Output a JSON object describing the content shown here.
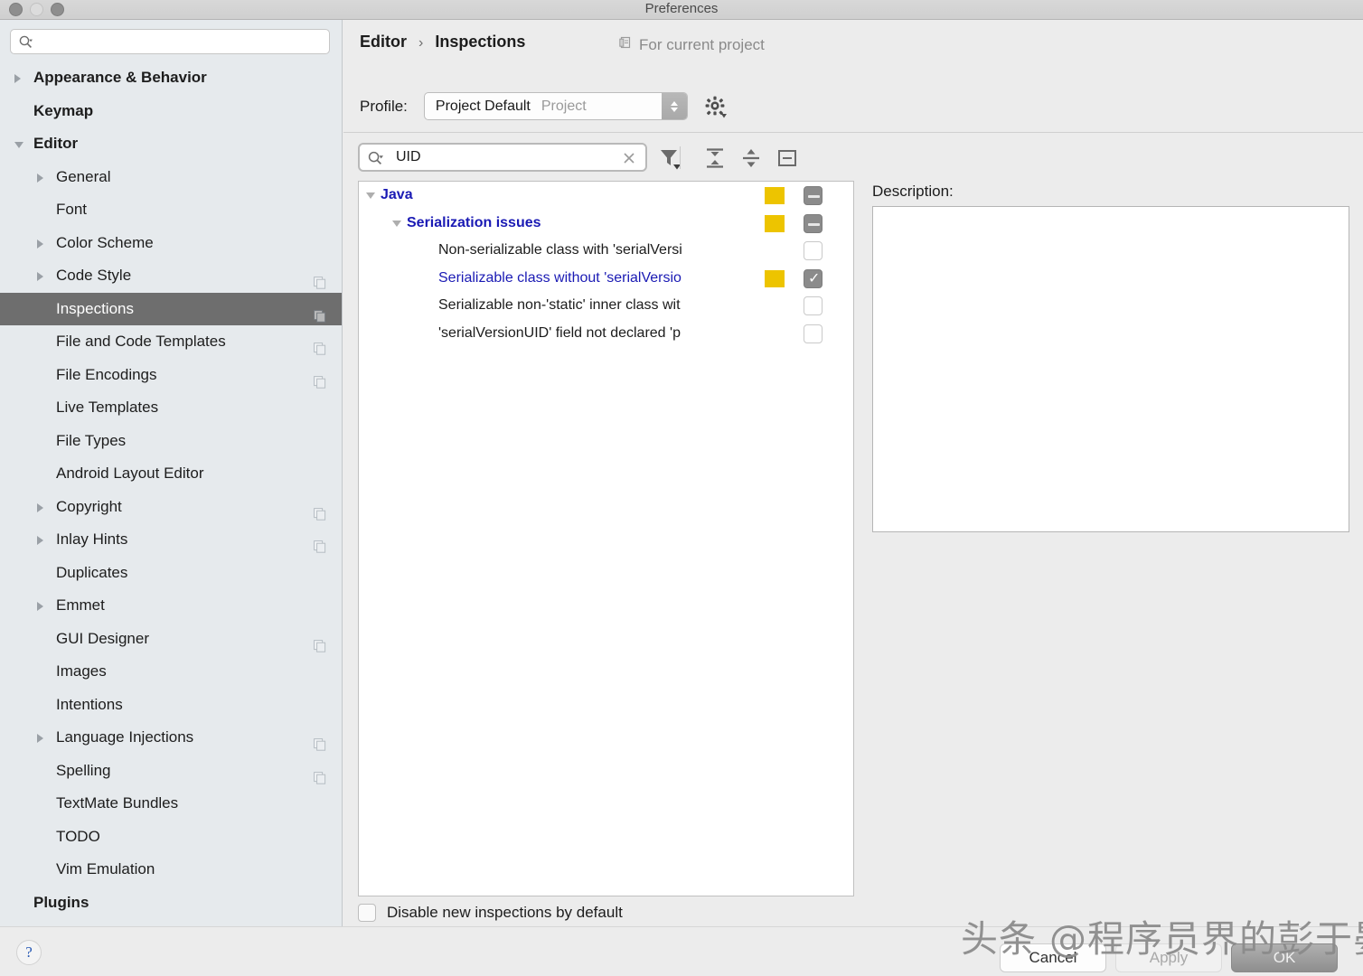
{
  "window": {
    "title": "Preferences",
    "traffic_lights": [
      "close-button",
      "minimize-button",
      "zoom-button"
    ]
  },
  "sidebar": {
    "search": {
      "value": "",
      "placeholder": ""
    },
    "items": [
      {
        "label": "Appearance & Behavior",
        "level": 0,
        "arrow": "right",
        "bold": true,
        "copy": false,
        "selected": false
      },
      {
        "label": "Keymap",
        "level": 0,
        "arrow": "none",
        "bold": true,
        "copy": false,
        "selected": false
      },
      {
        "label": "Editor",
        "level": 0,
        "arrow": "down",
        "bold": true,
        "copy": false,
        "selected": false
      },
      {
        "label": "General",
        "level": 1,
        "arrow": "right",
        "bold": false,
        "copy": false,
        "selected": false
      },
      {
        "label": "Font",
        "level": 1,
        "arrow": "none",
        "bold": false,
        "copy": false,
        "selected": false
      },
      {
        "label": "Color Scheme",
        "level": 1,
        "arrow": "right",
        "bold": false,
        "copy": false,
        "selected": false
      },
      {
        "label": "Code Style",
        "level": 1,
        "arrow": "right",
        "bold": false,
        "copy": true,
        "selected": false
      },
      {
        "label": "Inspections",
        "level": 1,
        "arrow": "none",
        "bold": false,
        "copy": true,
        "selected": true
      },
      {
        "label": "File and Code Templates",
        "level": 1,
        "arrow": "none",
        "bold": false,
        "copy": true,
        "selected": false
      },
      {
        "label": "File Encodings",
        "level": 1,
        "arrow": "none",
        "bold": false,
        "copy": true,
        "selected": false
      },
      {
        "label": "Live Templates",
        "level": 1,
        "arrow": "none",
        "bold": false,
        "copy": false,
        "selected": false
      },
      {
        "label": "File Types",
        "level": 1,
        "arrow": "none",
        "bold": false,
        "copy": false,
        "selected": false
      },
      {
        "label": "Android Layout Editor",
        "level": 1,
        "arrow": "none",
        "bold": false,
        "copy": false,
        "selected": false
      },
      {
        "label": "Copyright",
        "level": 1,
        "arrow": "right",
        "bold": false,
        "copy": true,
        "selected": false
      },
      {
        "label": "Inlay Hints",
        "level": 1,
        "arrow": "right",
        "bold": false,
        "copy": true,
        "selected": false
      },
      {
        "label": "Duplicates",
        "level": 1,
        "arrow": "none",
        "bold": false,
        "copy": false,
        "selected": false
      },
      {
        "label": "Emmet",
        "level": 1,
        "arrow": "right",
        "bold": false,
        "copy": false,
        "selected": false
      },
      {
        "label": "GUI Designer",
        "level": 1,
        "arrow": "none",
        "bold": false,
        "copy": true,
        "selected": false
      },
      {
        "label": "Images",
        "level": 1,
        "arrow": "none",
        "bold": false,
        "copy": false,
        "selected": false
      },
      {
        "label": "Intentions",
        "level": 1,
        "arrow": "none",
        "bold": false,
        "copy": false,
        "selected": false
      },
      {
        "label": "Language Injections",
        "level": 1,
        "arrow": "right",
        "bold": false,
        "copy": true,
        "selected": false
      },
      {
        "label": "Spelling",
        "level": 1,
        "arrow": "none",
        "bold": false,
        "copy": true,
        "selected": false
      },
      {
        "label": "TextMate Bundles",
        "level": 1,
        "arrow": "none",
        "bold": false,
        "copy": false,
        "selected": false
      },
      {
        "label": "TODO",
        "level": 1,
        "arrow": "none",
        "bold": false,
        "copy": false,
        "selected": false
      },
      {
        "label": "Vim Emulation",
        "level": 1,
        "arrow": "none",
        "bold": false,
        "copy": false,
        "selected": false
      },
      {
        "label": "Plugins",
        "level": 0,
        "arrow": "none",
        "bold": true,
        "copy": false,
        "selected": false
      }
    ]
  },
  "content": {
    "breadcrumb": {
      "parent": "Editor",
      "separator": "›",
      "current": "Inspections"
    },
    "for_current_project": "For current project",
    "profile": {
      "label": "Profile:",
      "value": "Project Default",
      "scope": "Project",
      "gear_tooltip": "Profile actions"
    },
    "inspection_search": {
      "value": "UID",
      "placeholder": ""
    },
    "toolbar": [
      {
        "name": "filter-icon",
        "label": "Filter"
      },
      {
        "name": "expand-all-icon",
        "label": "Expand All"
      },
      {
        "name": "collapse-all-icon",
        "label": "Collapse All"
      },
      {
        "name": "show-only-enabled-icon",
        "label": "Show Only Enabled"
      }
    ],
    "tree": [
      {
        "label": "Java",
        "level": 0,
        "kind": "group",
        "arrow": "down",
        "severity": "#EDC400",
        "checkbox": "tri"
      },
      {
        "label": "Serialization issues",
        "level": 1,
        "kind": "group",
        "arrow": "down",
        "severity": "#EDC400",
        "checkbox": "tri"
      },
      {
        "label": "Non-serializable class with 'serialVersi",
        "level": 2,
        "kind": "leaf",
        "arrow": "none",
        "severity": "",
        "checkbox": "unchecked"
      },
      {
        "label": "Serializable class without 'serialVersio",
        "level": 2,
        "kind": "leaf-hl",
        "arrow": "none",
        "severity": "#EDC400",
        "checkbox": "checked"
      },
      {
        "label": "Serializable non-'static' inner class wit",
        "level": 2,
        "kind": "leaf",
        "arrow": "none",
        "severity": "",
        "checkbox": "unchecked"
      },
      {
        "label": "'serialVersionUID' field not declared 'p",
        "level": 2,
        "kind": "leaf",
        "arrow": "none",
        "severity": "",
        "checkbox": "unchecked"
      }
    ],
    "description": {
      "label": "Description:",
      "text": ""
    },
    "disable_new": {
      "label": "Disable new inspections by default",
      "checked": false
    }
  },
  "footer": {
    "help": "?",
    "cancel": "Cancel",
    "apply": "Apply",
    "ok": "OK"
  },
  "watermark": {
    "text": "头条 @程序员界的彭于晏"
  },
  "colors": {
    "severity_warning": "#EDC400",
    "tree_group_text": "#1A1AB4",
    "selection": "#6E6E6E",
    "sidebar_bg": "#E6EAED",
    "content_bg": "#ECECEC"
  }
}
